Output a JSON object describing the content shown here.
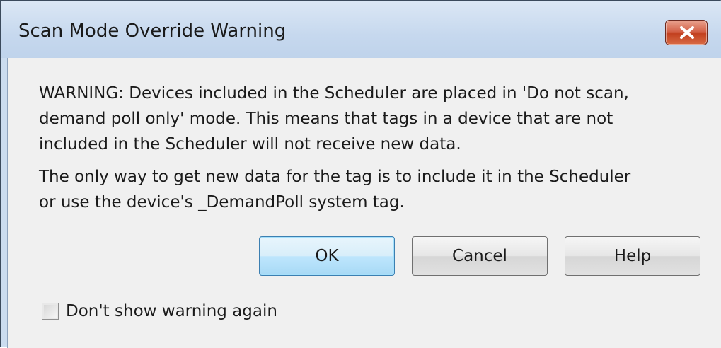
{
  "window": {
    "title": "Scan Mode Override Warning",
    "close_icon": "close-x-icon"
  },
  "message": {
    "paragraph1": [
      "WARNING: Devices included in the Scheduler are placed in 'Do not scan,",
      "demand poll only' mode. This means that tags in a device that are not",
      "included in the Scheduler will not receive new data."
    ],
    "paragraph2": [
      "The only way to get new data for the tag is to include it in the Scheduler",
      "or use the device's _DemandPoll system tag."
    ]
  },
  "buttons": {
    "ok": "OK",
    "cancel": "Cancel",
    "help": "Help"
  },
  "checkbox": {
    "label": "Don't show warning again",
    "checked": false
  },
  "colors": {
    "titlebar": "#c6d8ee",
    "close_button": "#c2401f",
    "dialog_body": "#f0f0f0",
    "default_button_border": "#3c7fb1"
  }
}
